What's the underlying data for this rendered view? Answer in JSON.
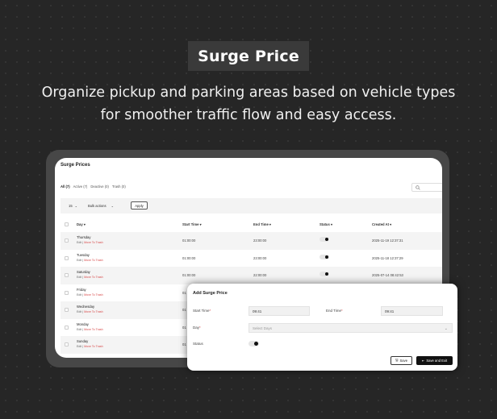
{
  "hero": {
    "title": "Surge Price",
    "subtitle_line1": "Organize pickup and parking areas based on vehicle types",
    "subtitle_line2": "for smoother traffic flow and easy access."
  },
  "page": {
    "title": "Surge Prices",
    "filters": [
      {
        "label": "All (7)",
        "active": true
      },
      {
        "label": "Active (7)",
        "active": false
      },
      {
        "label": "Deactive (0)",
        "active": false
      },
      {
        "label": "Trash (0)",
        "active": false
      }
    ],
    "search_icon": "search-icon",
    "toolbar": {
      "per_page": "15",
      "bulk_actions": "Bulk actions",
      "apply_label": "Apply"
    },
    "columns": {
      "day": "Day ▾",
      "start_time": "Start Time ▾",
      "end_time": "End Time ▾",
      "status": "Status ▾",
      "created_at": "Created At ▾"
    },
    "row_actions": {
      "edit": "Edit",
      "separator": " | ",
      "trash": "Move To Trash"
    },
    "rows": [
      {
        "day": "Thursday",
        "start": "01:00:00",
        "end": "23:00:00",
        "status": true,
        "created": "2025-11-19 12:37:31"
      },
      {
        "day": "Tuesday",
        "start": "01:00:00",
        "end": "23:00:00",
        "status": true,
        "created": "2025-11-18 12:37:29"
      },
      {
        "day": "Saturday",
        "start": "01:00:00",
        "end": "22:00:00",
        "status": true,
        "created": "2025-07-14 08:42:53"
      },
      {
        "day": "Friday",
        "start": "01",
        "end": "",
        "status": null,
        "created": ""
      },
      {
        "day": "Wednesday",
        "start": "01",
        "end": "",
        "status": null,
        "created": ""
      },
      {
        "day": "Monday",
        "start": "01",
        "end": "",
        "status": null,
        "created": ""
      },
      {
        "day": "Sunday",
        "start": "01",
        "end": "",
        "status": null,
        "created": ""
      }
    ]
  },
  "modal": {
    "title": "Add Surge Price",
    "start_time_label": "Start Time",
    "start_time_value": "09:41",
    "end_time_label": "End Time",
    "end_time_value": "09:41",
    "day_label": "Day",
    "day_placeholder": "Select Days",
    "status_label": "Status",
    "required_mark": "*",
    "save_label": "Save",
    "save_exit_label": "Save and Exit"
  },
  "colors": {
    "background": "#262626",
    "frame": "#474747",
    "danger": "#d84a4a",
    "primary_button": "#111111"
  }
}
